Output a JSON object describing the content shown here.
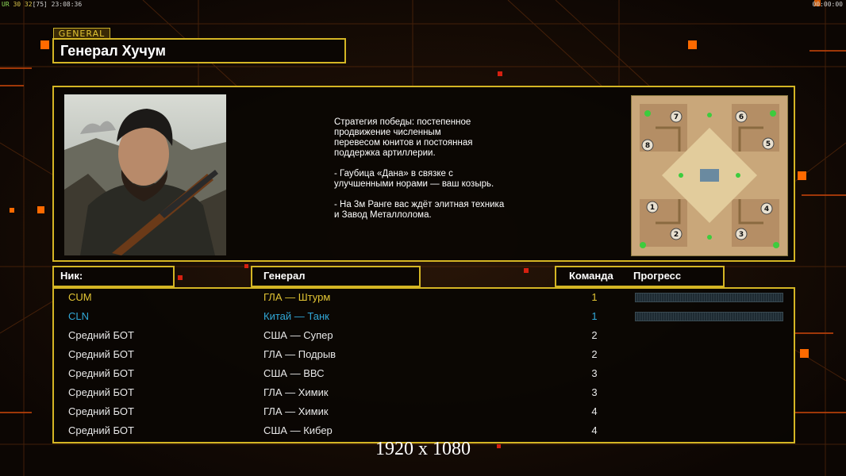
{
  "debug": {
    "left_prefix": "UR",
    "left_nums": "30 32",
    "left_bracket": "[75]",
    "left_time": "23:08:36",
    "right_time": "00:00:00"
  },
  "general": {
    "tag": "GENERAL",
    "title": "Генерал Хучум",
    "portrait_icon": "general-portrait",
    "description": "Стратегия победы: постепенное\nпродвижение численным\nперевесом юнитов и постоянная\nподдержка артиллерии.\n\n- Гаубица «Дана» в связке с\nулучшенными норами — ваш козырь.\n\n- На 3м Ранге вас ждёт элитная техника\nи Завод Металлолома."
  },
  "minimap": {
    "start_positions": [
      "1",
      "2",
      "3",
      "4",
      "5",
      "6",
      "7",
      "8"
    ]
  },
  "headers": {
    "nick": "Ник:",
    "general": "Генерал",
    "team": "Команда",
    "progress": "Прогресс"
  },
  "players": [
    {
      "nick": "CUM",
      "general": "ГЛА — Штурм",
      "team": "1",
      "color": "#e3c534",
      "progress": 0
    },
    {
      "nick": "CLN",
      "general": "Китай — Танк",
      "team": "1",
      "color": "#31a8d8",
      "progress": 0
    },
    {
      "nick": "Средний БОТ",
      "general": "США — Супер",
      "team": "2",
      "color": "#e8e8e8"
    },
    {
      "nick": "Средний БОТ",
      "general": "ГЛА — Подрыв",
      "team": "2",
      "color": "#e8e8e8"
    },
    {
      "nick": "Средний БОТ",
      "general": "США — ВВС",
      "team": "3",
      "color": "#e8e8e8"
    },
    {
      "nick": "Средний БОТ",
      "general": "ГЛА — Химик",
      "team": "3",
      "color": "#e8e8e8"
    },
    {
      "nick": "Средний БОТ",
      "general": "ГЛА — Химик",
      "team": "4",
      "color": "#e8e8e8"
    },
    {
      "nick": "Средний БОТ",
      "general": "США — Кибер",
      "team": "4",
      "color": "#e8e8e8"
    }
  ],
  "footer": {
    "resolution": "1920 x 1080"
  },
  "colors": {
    "accent": "#d4b524",
    "background": "#120904",
    "decor_orange": "#ff6a00"
  }
}
